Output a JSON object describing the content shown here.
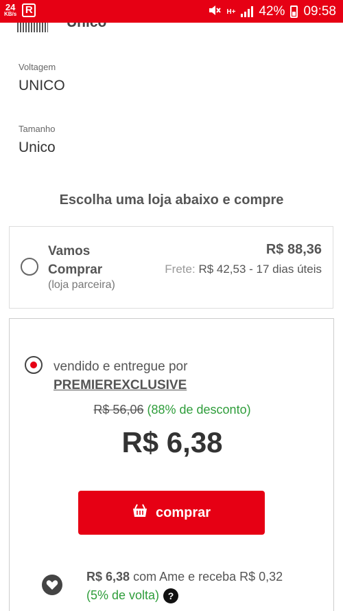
{
  "status_bar": {
    "speed_value": "24",
    "speed_unit": "KB/s",
    "app_icon_letter": "R",
    "network_type": "H+",
    "battery": "42%",
    "time": "09:58"
  },
  "partial_row": {
    "value": "Unico"
  },
  "attributes": [
    {
      "label": "Voltagem",
      "value": "UNICO"
    },
    {
      "label": "Tamanho",
      "value": "Unico"
    }
  ],
  "section_title": "Escolha uma loja abaixo e compre",
  "stores": [
    {
      "name": "Vamos Comprar",
      "subtitle": "(loja parceira)",
      "price": "R$ 88,36",
      "shipping_label": "Frete:",
      "shipping_value": "R$ 42,53 - 17 dias úteis",
      "selected": false
    },
    {
      "sold_by_text": "vendido e entregue por",
      "seller": "PREMIEREXCLUSIVE",
      "old_price": "R$ 56,06",
      "discount": "(88% de desconto)",
      "price": "R$ 6,38",
      "buy_label": "comprar",
      "selected": true,
      "cashback": {
        "price": "R$ 6,38",
        "text": "com Ame e receba R$ 0,32",
        "percent": "(5% de volta)",
        "help": "?"
      }
    }
  ],
  "colors": {
    "brand_red": "#e60014",
    "discount_green": "#2e9d3a"
  }
}
